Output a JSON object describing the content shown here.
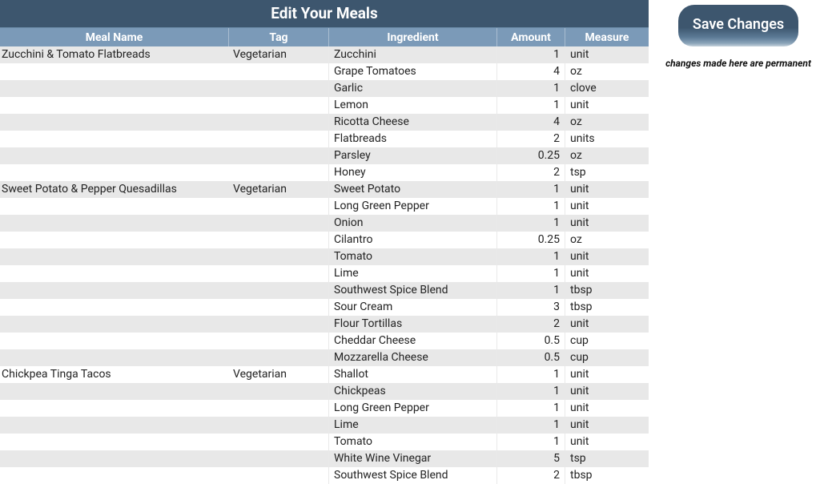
{
  "title": "Edit Your Meals",
  "save_button": "Save Changes",
  "warning": "changes made here are permanent",
  "headers": {
    "meal_name": "Meal Name",
    "tag": "Tag",
    "ingredient": "Ingredient",
    "amount": "Amount",
    "measure": "Measure"
  },
  "rows": [
    {
      "meal_name": "Zucchini & Tomato Flatbreads",
      "tag": "Vegetarian",
      "ingredient": "Zucchini",
      "amount": "1",
      "measure": "unit"
    },
    {
      "meal_name": "",
      "tag": "",
      "ingredient": "Grape Tomatoes",
      "amount": "4",
      "measure": "oz"
    },
    {
      "meal_name": "",
      "tag": "",
      "ingredient": "Garlic",
      "amount": "1",
      "measure": "clove"
    },
    {
      "meal_name": "",
      "tag": "",
      "ingredient": "Lemon",
      "amount": "1",
      "measure": "unit"
    },
    {
      "meal_name": "",
      "tag": "",
      "ingredient": "Ricotta Cheese",
      "amount": "4",
      "measure": "oz"
    },
    {
      "meal_name": "",
      "tag": "",
      "ingredient": "Flatbreads",
      "amount": "2",
      "measure": "units"
    },
    {
      "meal_name": "",
      "tag": "",
      "ingredient": "Parsley",
      "amount": "0.25",
      "measure": "oz"
    },
    {
      "meal_name": "",
      "tag": "",
      "ingredient": "Honey",
      "amount": "2",
      "measure": "tsp"
    },
    {
      "meal_name": "Sweet Potato & Pepper Quesadillas",
      "tag": "Vegetarian",
      "ingredient": "Sweet Potato",
      "amount": "1",
      "measure": "unit"
    },
    {
      "meal_name": "",
      "tag": "",
      "ingredient": "Long Green Pepper",
      "amount": "1",
      "measure": "unit"
    },
    {
      "meal_name": "",
      "tag": "",
      "ingredient": "Onion",
      "amount": "1",
      "measure": "unit"
    },
    {
      "meal_name": "",
      "tag": "",
      "ingredient": "Cilantro",
      "amount": "0.25",
      "measure": "oz"
    },
    {
      "meal_name": "",
      "tag": "",
      "ingredient": "Tomato",
      "amount": "1",
      "measure": "unit"
    },
    {
      "meal_name": "",
      "tag": "",
      "ingredient": "Lime",
      "amount": "1",
      "measure": "unit"
    },
    {
      "meal_name": "",
      "tag": "",
      "ingredient": "Southwest Spice Blend",
      "amount": "1",
      "measure": "tbsp"
    },
    {
      "meal_name": "",
      "tag": "",
      "ingredient": "Sour Cream",
      "amount": "3",
      "measure": "tbsp"
    },
    {
      "meal_name": "",
      "tag": "",
      "ingredient": "Flour Tortillas",
      "amount": "2",
      "measure": "unit"
    },
    {
      "meal_name": "",
      "tag": "",
      "ingredient": "Cheddar Cheese",
      "amount": "0.5",
      "measure": "cup"
    },
    {
      "meal_name": "",
      "tag": "",
      "ingredient": "Mozzarella Cheese",
      "amount": "0.5",
      "measure": "cup"
    },
    {
      "meal_name": "Chickpea Tinga Tacos",
      "tag": "Vegetarian",
      "ingredient": "Shallot",
      "amount": "1",
      "measure": "unit"
    },
    {
      "meal_name": "",
      "tag": "",
      "ingredient": "Chickpeas",
      "amount": "1",
      "measure": "unit"
    },
    {
      "meal_name": "",
      "tag": "",
      "ingredient": "Long Green Pepper",
      "amount": "1",
      "measure": "unit"
    },
    {
      "meal_name": "",
      "tag": "",
      "ingredient": "Lime",
      "amount": "1",
      "measure": "unit"
    },
    {
      "meal_name": "",
      "tag": "",
      "ingredient": "Tomato",
      "amount": "1",
      "measure": "unit"
    },
    {
      "meal_name": "",
      "tag": "",
      "ingredient": "White Wine Vinegar",
      "amount": "5",
      "measure": "tsp"
    },
    {
      "meal_name": "",
      "tag": "",
      "ingredient": "Southwest Spice Blend",
      "amount": "2",
      "measure": "tbsp"
    }
  ]
}
